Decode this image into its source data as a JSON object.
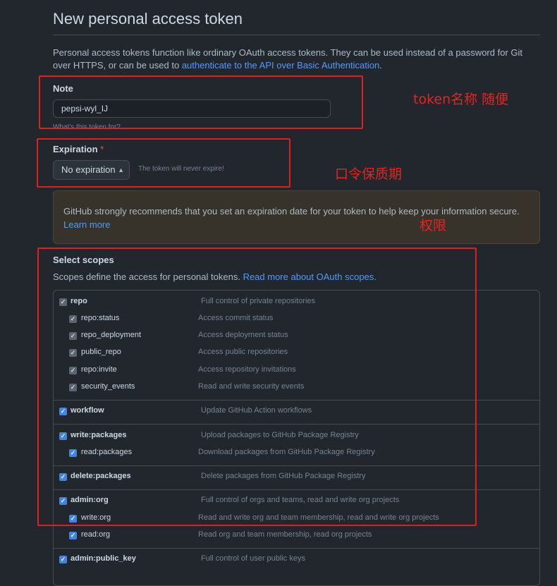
{
  "title": "New personal access token",
  "intro": {
    "text": "Personal access tokens function like ordinary OAuth access tokens. They can be used instead of a password for Git over HTTPS, or can be used to ",
    "link": "authenticate to the API over Basic Authentication",
    "suffix": "."
  },
  "note": {
    "label": "Note",
    "value": "pepsi-wyl_IJ",
    "hint": "What's this token for?"
  },
  "expiration": {
    "label": "Expiration",
    "required_mark": "*",
    "selected": "No expiration",
    "hint": "The token will never expire!"
  },
  "warning": {
    "text": "GitHub strongly recommends that you set an expiration date for your token to help keep your information secure.",
    "link": "Learn more"
  },
  "scopes": {
    "title": "Select scopes",
    "desc": "Scopes define the access for personal tokens.",
    "link": "Read more about OAuth scopes."
  },
  "scope_rows": [
    {
      "name": "repo",
      "desc": "Full control of private repositories",
      "checked": true
    },
    {
      "name": "repo:status",
      "desc": "Access commit status",
      "checked": true
    },
    {
      "name": "repo_deployment",
      "desc": "Access deployment status",
      "checked": true
    },
    {
      "name": "public_repo",
      "desc": "Access public repositories",
      "checked": true
    },
    {
      "name": "repo:invite",
      "desc": "Access repository invitations",
      "checked": true
    },
    {
      "name": "security_events",
      "desc": "Read and write security events",
      "checked": true
    },
    {
      "name": "workflow",
      "desc": "Update GitHub Action workflows",
      "checked": true
    },
    {
      "name": "write:packages",
      "desc": "Upload packages to GitHub Package Registry",
      "checked": true
    },
    {
      "name": "read:packages",
      "desc": "Download packages from GitHub Package Registry",
      "checked": true
    },
    {
      "name": "delete:packages",
      "desc": "Delete packages from GitHub Package Registry",
      "checked": true
    },
    {
      "name": "admin:org",
      "desc": "Full control of orgs and teams, read and write org projects",
      "checked": true
    },
    {
      "name": "write:org",
      "desc": "Read and write org and team membership, read and write org projects",
      "checked": true
    },
    {
      "name": "read:org",
      "desc": "Read org and team membership, read org projects",
      "checked": true
    },
    {
      "name": "admin:public_key",
      "desc": "Full control of user public keys",
      "checked": true
    }
  ],
  "annotations": {
    "note": "token名称 随便",
    "expiration": "口令保质期",
    "scopes": "权限"
  },
  "colors": {
    "background": "#22272e",
    "link": "#539bf5",
    "checkbox": "#4184e4",
    "annotation": "#e8231e"
  }
}
